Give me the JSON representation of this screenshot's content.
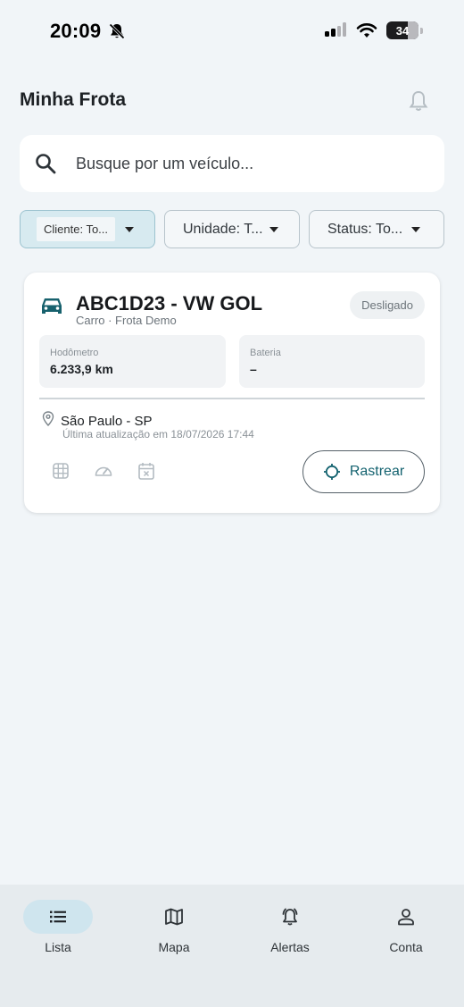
{
  "status_bar": {
    "time": "20:09",
    "battery": "34"
  },
  "header": {
    "title": "Minha Frota"
  },
  "search": {
    "placeholder": "Busque por um veículo..."
  },
  "filters": [
    {
      "label": "Cliente: To...",
      "active": true
    },
    {
      "label": "Unidade: T...",
      "active": false
    },
    {
      "label": "Status: To...",
      "active": false
    }
  ],
  "vehicle": {
    "title": "ABC1D23 - VW GOL",
    "subtitle": "Carro · Frota Demo",
    "state": "Desligado",
    "odometer_label": "Hodômetro",
    "odometer_value": "6.233,9 km",
    "battery_label": "Bateria",
    "battery_value": "–",
    "location": "São Paulo - SP",
    "updated": "Última atualização em 18/07/2026 17:44",
    "track_label": "Rastrear"
  },
  "nav": [
    {
      "label": "Lista",
      "icon": "list-icon",
      "active": true
    },
    {
      "label": "Mapa",
      "icon": "map-icon",
      "active": false
    },
    {
      "label": "Alertas",
      "icon": "alert-bell-icon",
      "active": false
    },
    {
      "label": "Conta",
      "icon": "person-icon",
      "active": false
    }
  ],
  "colors": {
    "accent": "#13626f",
    "active_filter_bg": "#d7eaf0",
    "nav_active_pill": "#cfe5ee",
    "background": "#f1f5f8"
  }
}
